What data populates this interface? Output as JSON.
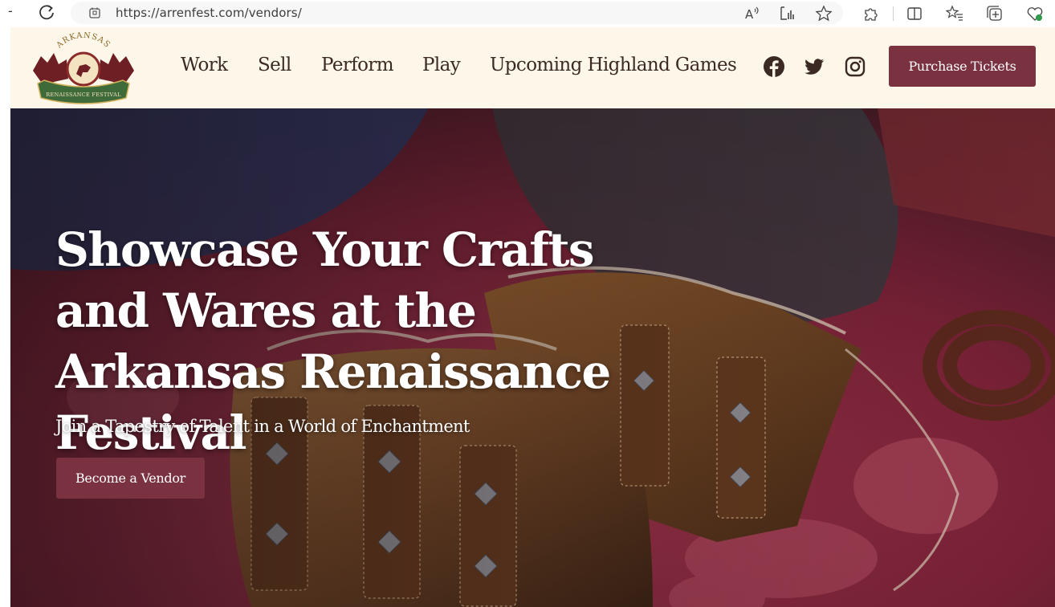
{
  "browser": {
    "url": "https://arrenfest.com/vendors/",
    "toolbar_icons": [
      "reload-icon",
      "site-info-icon",
      "read-aloud-icon",
      "reading-view-icon",
      "favorite-star-icon",
      "extensions-icon",
      "split-screen-icon",
      "favorites-icon",
      "collections-icon",
      "browser-essentials-icon"
    ]
  },
  "site": {
    "logo": {
      "top_text": "ARKANSAS",
      "banner_text": "RENAISSANCE FESTIVAL",
      "alt": "Arkansas Renaissance Festival logo"
    },
    "nav": [
      {
        "label": "Work"
      },
      {
        "label": "Sell"
      },
      {
        "label": "Perform"
      },
      {
        "label": "Play"
      },
      {
        "label": "Upcoming Highland Games"
      }
    ],
    "social": [
      "facebook-icon",
      "twitter-icon",
      "instagram-icon"
    ],
    "cta_label": "Purchase Tickets",
    "colors": {
      "header_bg": "#fdf7ea",
      "brand_button": "#7a3140",
      "nav_text": "#3b2a24",
      "logo_gold": "#d4b15a",
      "logo_green": "#3f6a3a",
      "logo_red": "#8a2a2a"
    }
  },
  "hero": {
    "title": "Showcase Your Crafts and Wares at the Arkansas Renaissance Festival",
    "subtitle": "Join a Tapestry of Talent in a World of Enchantment",
    "button_label": "Become a Vendor",
    "image_description": "leather bracers with metal studs on red damask cloth"
  }
}
